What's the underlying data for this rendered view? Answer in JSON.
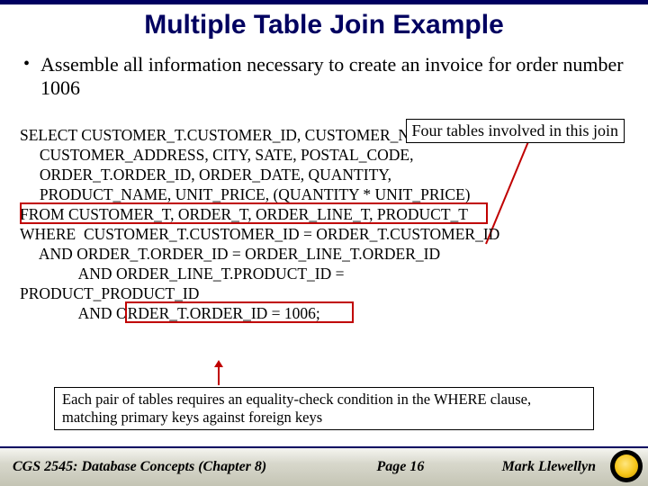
{
  "title": "Multiple Table Join Example",
  "bullet": "Assemble all information necessary to create an invoice for order number 1006",
  "callout_top": "Four tables involved in this join",
  "sql": {
    "l1": "SELECT CUSTOMER_T.CUSTOMER_ID, CUSTOMER_NAME,",
    "l2": "     CUSTOMER_ADDRESS, CITY, SATE, POSTAL_CODE,",
    "l3": "     ORDER_T.ORDER_ID, ORDER_DATE, QUANTITY,",
    "l4": "     PRODUCT_NAME, UNIT_PRICE, (QUANTITY * UNIT_PRICE)",
    "l5": "FROM CUSTOMER_T, ORDER_T, ORDER_LINE_T, PRODUCT_T",
    "l6": "WHERE  CUSTOMER_T.CUSTOMER_ID = ORDER_T.CUSTOMER_ID",
    "l7": "     AND ORDER_T.ORDER_ID = ORDER_LINE_T.ORDER_ID",
    "l8": "               AND ORDER_LINE_T.PRODUCT_ID =",
    "l9": "PRODUCT_PRODUCT_ID",
    "l10": "               AND ORDER_T.ORDER_ID = 1006;"
  },
  "callout_bottom": "Each pair of tables requires an equality-check condition in the WHERE clause, matching primary keys against foreign keys",
  "footer": {
    "left": "CGS 2545: Database Concepts  (Chapter 8)",
    "mid": "Page 16",
    "right": "Mark Llewellyn"
  }
}
